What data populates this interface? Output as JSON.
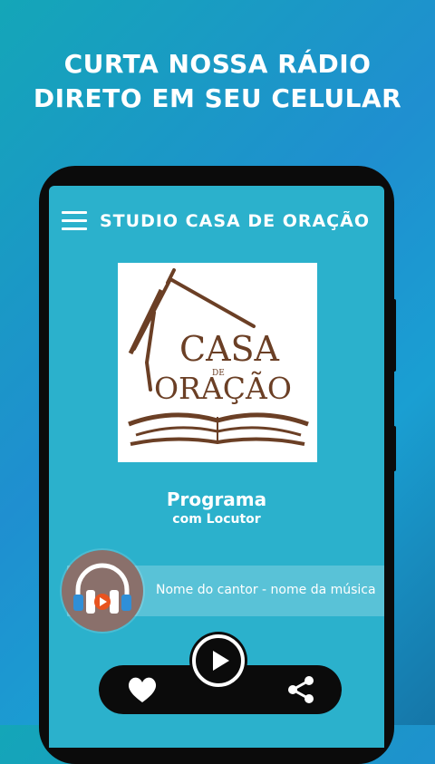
{
  "promo": {
    "line1": "CURTA NOSSA RÁDIO",
    "line2": "DIRETO EM SEU CELULAR"
  },
  "app": {
    "title": "STUDIO CASA DE ORAÇÃO"
  },
  "logo": {
    "word1": "CASA",
    "word_small": "DE",
    "word2": "ORAÇÃO"
  },
  "program": {
    "name": "Programa",
    "host": "com Locutor"
  },
  "now_playing": {
    "text": "Nome do cantor - nome da música"
  },
  "icons": {
    "menu": "hamburger-menu-icon",
    "avatar": "headphones-icon",
    "play": "play-icon",
    "like": "heart-icon",
    "share": "share-icon"
  },
  "colors": {
    "screen": "#2bb1cc",
    "logo_text": "#6b3f25",
    "accent": "#e8531f",
    "avatar_bg": "#8a706b"
  }
}
